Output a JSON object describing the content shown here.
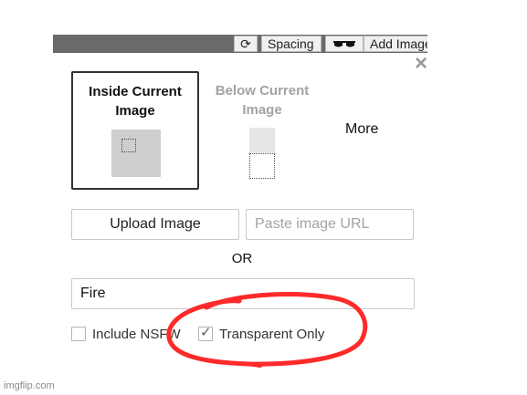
{
  "toolbar": {
    "refresh_icon": "refresh-icon",
    "spacing_label": "Spacing",
    "glasses_icon": "sunglasses-icon",
    "add_image_label": "Add Image"
  },
  "dialog": {
    "close_glyph": "×",
    "placement": {
      "inside": {
        "title_line1": "Inside Current",
        "title_line2": "Image",
        "selected": true
      },
      "below": {
        "title_line1": "Below Current",
        "title_line2": "Image",
        "selected": false
      },
      "more_label": "More"
    },
    "upload_label": "Upload Image",
    "url": {
      "placeholder": "Paste image URL",
      "value": ""
    },
    "or_label": "OR",
    "search": {
      "value": "Fire"
    },
    "options": {
      "nsfw": {
        "label": "Include NSFW",
        "checked": false
      },
      "transparent": {
        "label": "Transparent Only",
        "checked": true,
        "check_glyph": "✓"
      }
    }
  },
  "annotation": {
    "color": "#ff2a2a",
    "shape": "hand-drawn circle around Transparent Only"
  },
  "watermark": "imgflip.com"
}
